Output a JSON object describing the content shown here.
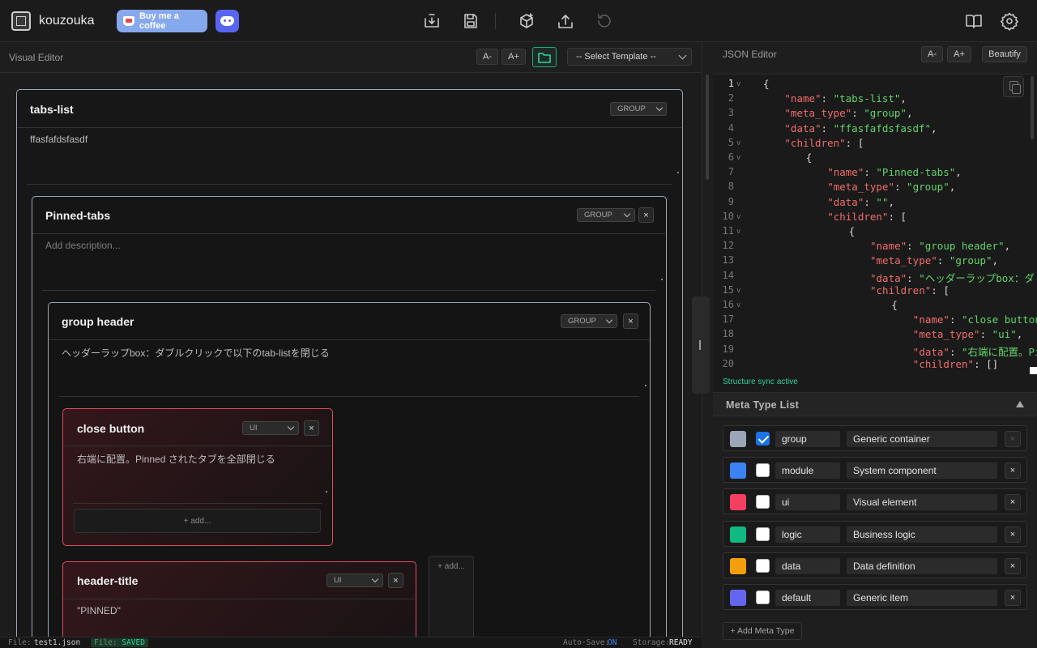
{
  "app": {
    "brand": "kouzouka",
    "coffee_label": "Buy me a coffee"
  },
  "toolbar": {
    "icons": [
      "download-icon",
      "save-icon",
      "cube-icon",
      "upload-icon",
      "undo-icon",
      "book-icon",
      "gear-icon"
    ]
  },
  "visual_editor": {
    "title": "Visual Editor",
    "font_dec": "A-",
    "font_inc": "A+",
    "template_select": "-- Select Template --"
  },
  "nodes": {
    "tabs_list": {
      "title": "tabs-list",
      "type": "GROUP",
      "desc": "ffasfafdsfasdf"
    },
    "pinned_tabs": {
      "title": "Pinned-tabs",
      "type": "GROUP",
      "desc_placeholder": "Add description..."
    },
    "group_header": {
      "title": "group header",
      "type": "GROUP",
      "desc": "ヘッダーラップbox：ダブルクリックで以下のtab-listを閉じる"
    },
    "close_button": {
      "title": "close button",
      "type": "UI",
      "desc": "右端に配置。Pinned されたタブを全部閉じる",
      "add_label": "+ add..."
    },
    "header_title": {
      "title": "header-title",
      "type": "UI",
      "desc": "\"PINNED\""
    },
    "side_add_label": "+ add...",
    "close_symbol": "×"
  },
  "status": {
    "file_label": "File:",
    "file_name": "test1.json",
    "file_state_label": "File:",
    "file_state": "SAVED",
    "autosave_label": "Auto-Save:",
    "autosave": "ON",
    "storage_label": "Storage:",
    "storage": "READY"
  },
  "json_editor": {
    "title": "JSON Editor",
    "font_dec": "A-",
    "font_inc": "A+",
    "beautify": "Beautify",
    "lines": [
      {
        "n": "1",
        "fold": true,
        "text": "{"
      },
      {
        "n": "2",
        "fold": false,
        "indent": 1,
        "key": "\"name\"",
        "val": "\"tabs-list\"",
        "tail": ","
      },
      {
        "n": "3",
        "fold": false,
        "indent": 1,
        "key": "\"meta_type\"",
        "val": "\"group\"",
        "tail": ","
      },
      {
        "n": "4",
        "fold": false,
        "indent": 1,
        "key": "\"data\"",
        "val": "\"ffasfafdsfasdf\"",
        "tail": ","
      },
      {
        "n": "5",
        "fold": true,
        "indent": 1,
        "key": "\"children\"",
        "val": "",
        "tail": "["
      },
      {
        "n": "6",
        "fold": true,
        "indent": 2,
        "text": "{"
      },
      {
        "n": "7",
        "fold": false,
        "indent": 3,
        "key": "\"name\"",
        "val": "\"Pinned-tabs\"",
        "tail": ","
      },
      {
        "n": "8",
        "fold": false,
        "indent": 3,
        "key": "\"meta_type\"",
        "val": "\"group\"",
        "tail": ","
      },
      {
        "n": "9",
        "fold": false,
        "indent": 3,
        "key": "\"data\"",
        "val": "\"\"",
        "tail": ","
      },
      {
        "n": "10",
        "fold": true,
        "indent": 3,
        "key": "\"children\"",
        "val": "",
        "tail": "["
      },
      {
        "n": "11",
        "fold": true,
        "indent": 4,
        "text": "{"
      },
      {
        "n": "12",
        "fold": false,
        "indent": 5,
        "key": "\"name\"",
        "val": "\"group header\"",
        "tail": ","
      },
      {
        "n": "13",
        "fold": false,
        "indent": 5,
        "key": "\"meta_type\"",
        "val": "\"group\"",
        "tail": ","
      },
      {
        "n": "14",
        "fold": false,
        "indent": 5,
        "key": "\"data\"",
        "val": "\"ヘッダーラップbox：ダ",
        "tail": ""
      },
      {
        "n": "15",
        "fold": true,
        "indent": 5,
        "key": "\"children\"",
        "val": "",
        "tail": "["
      },
      {
        "n": "16",
        "fold": true,
        "indent": 6,
        "text": "{"
      },
      {
        "n": "17",
        "fold": false,
        "indent": 7,
        "key": "\"name\"",
        "val": "\"close button\"",
        "tail": ","
      },
      {
        "n": "18",
        "fold": false,
        "indent": 7,
        "key": "\"meta_type\"",
        "val": "\"ui\"",
        "tail": ","
      },
      {
        "n": "19",
        "fold": false,
        "indent": 7,
        "key": "\"data\"",
        "val": "\"右端に配置。Pi",
        "tail": ""
      },
      {
        "n": "20",
        "fold": false,
        "indent": 7,
        "key": "\"children\"",
        "val": "",
        "tail": "[]"
      }
    ],
    "sync_status": "Structure sync active"
  },
  "meta_types": {
    "title": "Meta Type List",
    "items": [
      {
        "name": "group",
        "desc": "Generic container",
        "color": "#9aa6b8",
        "checked": true
      },
      {
        "name": "module",
        "desc": "System component",
        "color": "#3b82f6",
        "checked": false
      },
      {
        "name": "ui",
        "desc": "Visual element",
        "color": "#f43f5e",
        "checked": false
      },
      {
        "name": "logic",
        "desc": "Business logic",
        "color": "#10b981",
        "checked": false
      },
      {
        "name": "data",
        "desc": "Data definition",
        "color": "#f59e0b",
        "checked": false
      },
      {
        "name": "default",
        "desc": "Generic item",
        "color": "#6366f1",
        "checked": false
      }
    ],
    "add_label": "+ Add Meta Type"
  }
}
